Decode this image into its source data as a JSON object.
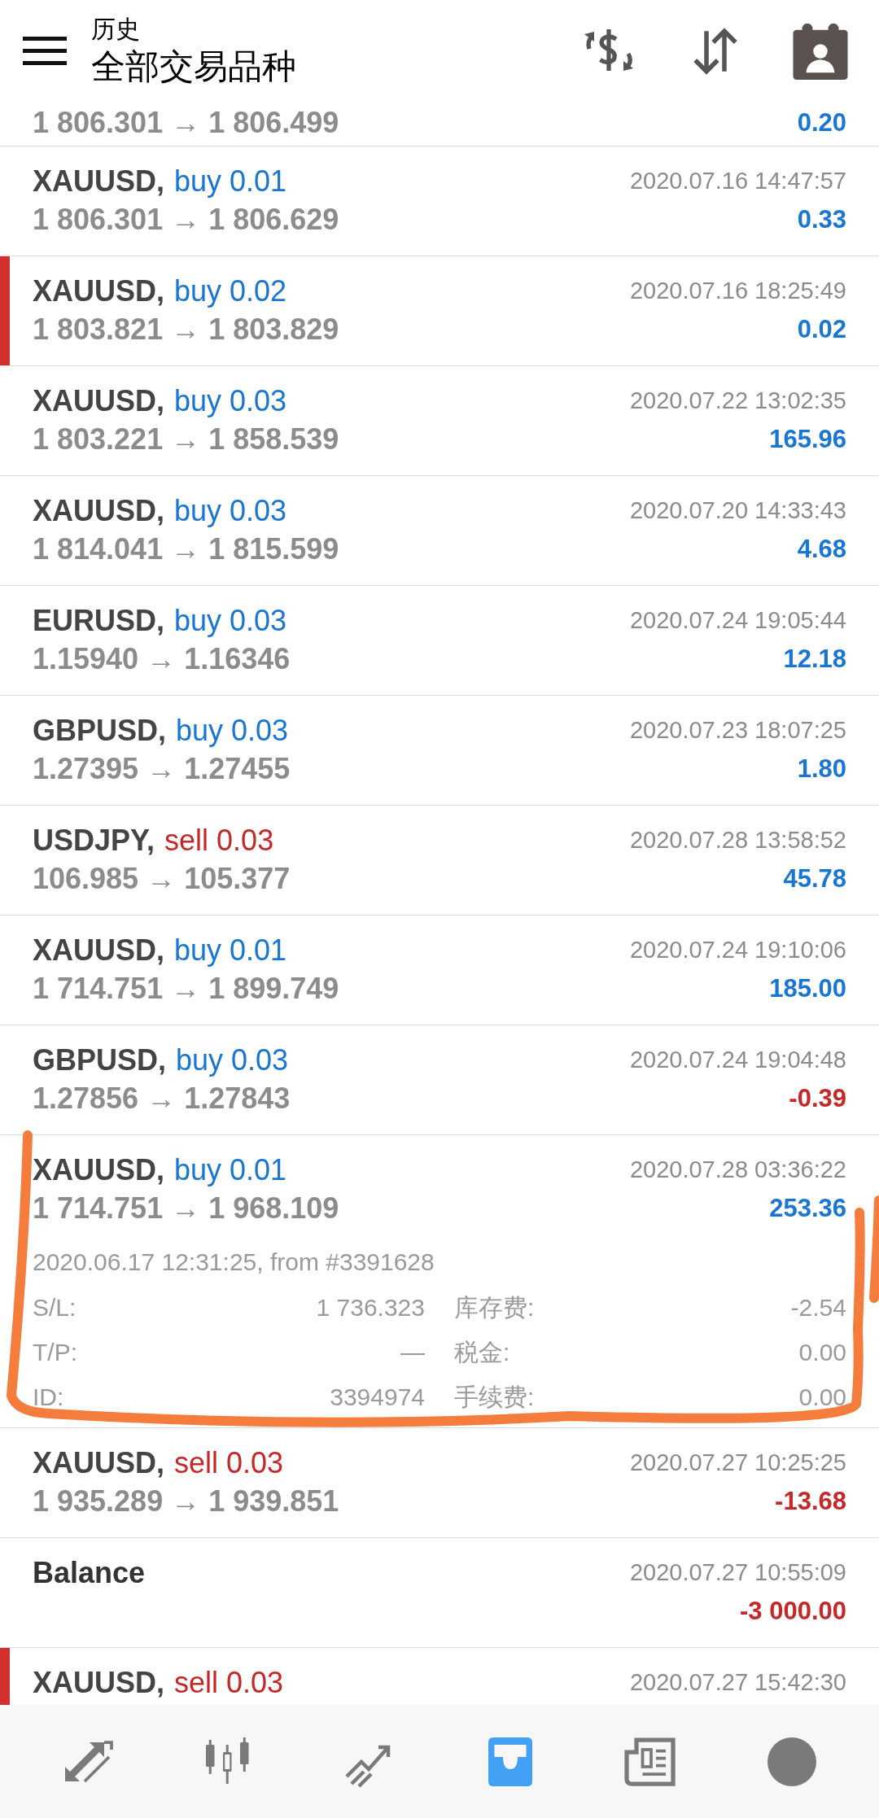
{
  "header": {
    "subtitle": "历史",
    "title": "全部交易品种"
  },
  "rows": [
    {
      "prices": "1 806.301 → 1 806.499",
      "profit": "0.20",
      "negative": false
    },
    {
      "kind": "buy",
      "symbol": "XAUUSD,",
      "type": "buy 0.01",
      "prices": "1 806.301 → 1 806.629",
      "time": "2020.07.16 14:47:57",
      "profit": "0.33",
      "negative": false,
      "marked": false,
      "expanded": false
    },
    {
      "kind": "buy",
      "symbol": "XAUUSD,",
      "type": "buy 0.02",
      "prices": "1 803.821 → 1 803.829",
      "time": "2020.07.16 18:25:49",
      "profit": "0.02",
      "negative": false,
      "marked": true,
      "expanded": false
    },
    {
      "kind": "buy",
      "symbol": "XAUUSD,",
      "type": "buy 0.03",
      "prices": "1 803.221 → 1 858.539",
      "time": "2020.07.22 13:02:35",
      "profit": "165.96",
      "negative": false,
      "marked": false,
      "expanded": false
    },
    {
      "kind": "buy",
      "symbol": "XAUUSD,",
      "type": "buy 0.03",
      "prices": "1 814.041 → 1 815.599",
      "time": "2020.07.20 14:33:43",
      "profit": "4.68",
      "negative": false,
      "marked": false,
      "expanded": false
    },
    {
      "kind": "buy",
      "symbol": "EURUSD,",
      "type": "buy 0.03",
      "prices": "1.15940 → 1.16346",
      "time": "2020.07.24 19:05:44",
      "profit": "12.18",
      "negative": false,
      "marked": false,
      "expanded": false
    },
    {
      "kind": "buy",
      "symbol": "GBPUSD,",
      "type": "buy 0.03",
      "prices": "1.27395 → 1.27455",
      "time": "2020.07.23 18:07:25",
      "profit": "1.80",
      "negative": false,
      "marked": false,
      "expanded": false
    },
    {
      "kind": "sell",
      "symbol": "USDJPY,",
      "type": "sell 0.03",
      "prices": "106.985 → 105.377",
      "time": "2020.07.28 13:58:52",
      "profit": "45.78",
      "negative": false,
      "marked": false,
      "expanded": false
    },
    {
      "kind": "buy",
      "symbol": "XAUUSD,",
      "type": "buy 0.01",
      "prices": "1 714.751 → 1 899.749",
      "time": "2020.07.24 19:10:06",
      "profit": "185.00",
      "negative": false,
      "marked": false,
      "expanded": false
    },
    {
      "kind": "buy",
      "symbol": "GBPUSD,",
      "type": "buy 0.03",
      "prices": "1.27856 → 1.27843",
      "time": "2020.07.24 19:04:48",
      "profit": "-0.39",
      "negative": true,
      "marked": false,
      "expanded": false
    },
    {
      "kind": "buy",
      "symbol": "XAUUSD,",
      "type": "buy 0.01",
      "prices": "1 714.751 → 1 968.109",
      "time": "2020.07.28 03:36:22",
      "profit": "253.36",
      "negative": false,
      "marked": false,
      "expanded": true,
      "open_info": "2020.06.17 12:31:25, from #3391628",
      "details": [
        {
          "label": "S/L:",
          "value": "1 736.323"
        },
        {
          "label": "库存费:",
          "value": "-2.54"
        },
        {
          "label": "T/P:",
          "value": "—"
        },
        {
          "label": "税金:",
          "value": "0.00"
        },
        {
          "label": "ID:",
          "value": "3394974"
        },
        {
          "label": "手续费:",
          "value": "0.00"
        }
      ]
    },
    {
      "kind": "sell",
      "symbol": "XAUUSD,",
      "type": "sell 0.03",
      "prices": "1 935.289 → 1 939.851",
      "time": "2020.07.27 10:25:25",
      "profit": "-13.68",
      "negative": true,
      "marked": false,
      "expanded": false
    },
    {
      "kind": "balance",
      "symbol": "Balance",
      "time": "2020.07.27 10:55:09",
      "profit": "-3 000.00",
      "negative": true,
      "marked": false,
      "expanded": false
    },
    {
      "kind": "sell",
      "symbol": "XAUUSD,",
      "type": "sell 0.03",
      "time": "2020.07.27 15:42:30",
      "marked": true
    }
  ],
  "annotation": {
    "color": "#f47c3c"
  },
  "nav": [
    {
      "kind": "trade",
      "selected": false
    },
    {
      "kind": "chart",
      "selected": false
    },
    {
      "kind": "trend",
      "selected": false
    },
    {
      "kind": "history",
      "selected": true
    },
    {
      "kind": "news",
      "selected": false
    },
    {
      "kind": "chat",
      "selected": false
    }
  ]
}
